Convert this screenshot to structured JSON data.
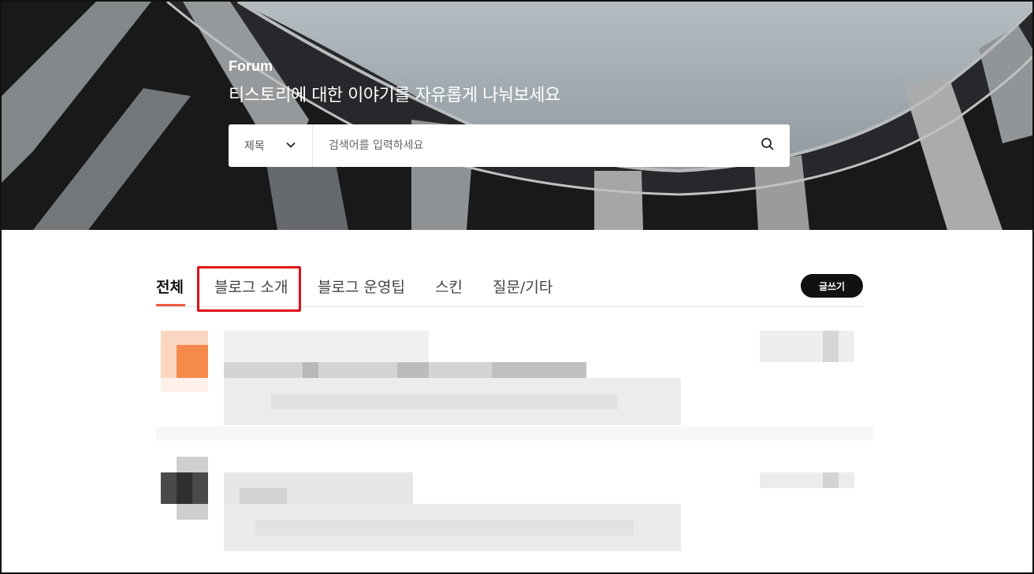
{
  "hero": {
    "kicker": "Forum",
    "title": "티스토리에 대한 이야기를 자유롭게 나눠보세요"
  },
  "search": {
    "field_label": "제목",
    "placeholder": "검색어를 입력하세요",
    "icons": {
      "dropdown": "chevron-down-icon",
      "submit": "search-icon"
    }
  },
  "tabs": [
    {
      "label": "전체",
      "active": true
    },
    {
      "label": "블로그 소개",
      "active": false,
      "highlighted": true
    },
    {
      "label": "블로그 운영팁",
      "active": false
    },
    {
      "label": "스킨",
      "active": false
    },
    {
      "label": "질문/기타",
      "active": false
    }
  ],
  "write_button": {
    "label": "글쓰기"
  },
  "colors": {
    "accent": "#ef5b3c",
    "highlight": "#e0101a",
    "write_button_bg": "#111111"
  },
  "posts_note": "pixelated"
}
